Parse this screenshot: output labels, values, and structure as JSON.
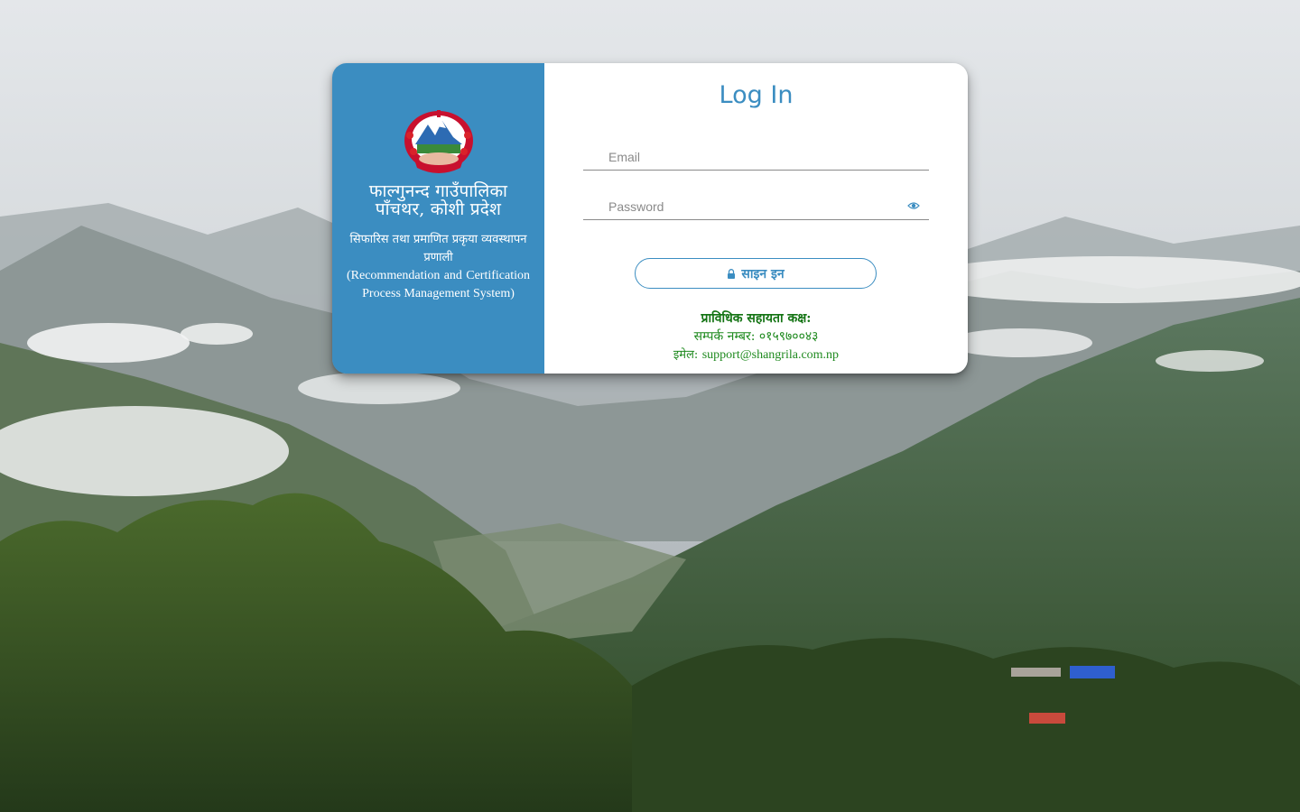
{
  "login": {
    "title": "Log In",
    "email_placeholder": "Email",
    "email_value": "",
    "password_placeholder": "Password",
    "password_value": "",
    "signin_label": "साइन इन",
    "lock_icon": "lock-icon",
    "eye_icon": "eye-icon"
  },
  "org": {
    "name_line1": "फाल्गुनन्द गाउँपालिका",
    "name_line2": "पाँचथर, कोशी प्रदेश",
    "system_np": "सिफारिस तथा प्रमाणित प्रकृया व्यवस्थापन प्रणाली",
    "system_en": "(Recommendation and Certification Process Management System)",
    "emblem": "nepal-government-emblem"
  },
  "support": {
    "heading": "प्राविधिक सहायता कक्ष:",
    "phone_line": "सम्पर्क नम्बर: ०१५९७००४३",
    "email_label": "इमेल:",
    "email": "support@shangrila.com.np"
  },
  "colors": {
    "primary": "#3b8dc1",
    "support_green": "#1f8a1f"
  }
}
